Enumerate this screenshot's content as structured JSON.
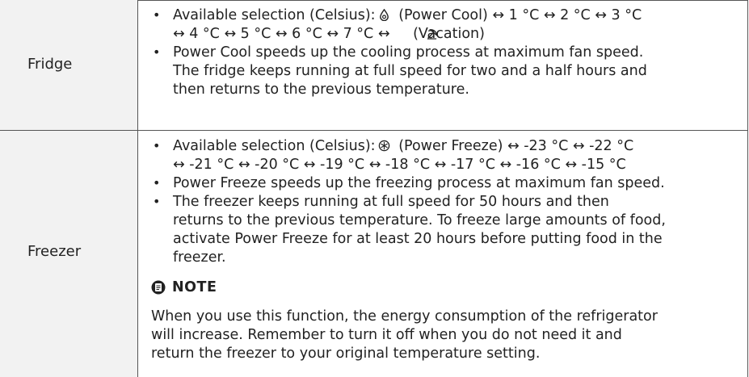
{
  "fridge": {
    "label": "Fridge",
    "bullets": [
      {
        "lines": [
          "Available selection (Celsius):   (Power Cool) ↔ 1 °C ↔ 2 °C ↔ 3 °C",
          "↔ 4 °C ↔ 5 °C ↔ 6 °C ↔ 7 °C ↔   (Vacation)"
        ]
      },
      {
        "lines": [
          "Power Cool speeds up the cooling process at maximum fan speed.",
          "The fridge keeps running at full speed for two and a half hours and",
          "then returns to the previous temperature."
        ]
      }
    ]
  },
  "freezer": {
    "label": "Freezer",
    "bullets": [
      {
        "lines": [
          "Available selection (Celsius):   (Power Freeze) ↔ -23 °C ↔ -22 °C",
          "↔ -21 °C ↔ -20 °C ↔ -19 °C ↔ -18 °C ↔ -17 °C ↔ -16 °C ↔ -15 °C"
        ]
      },
      {
        "lines": [
          "Power Freeze speeds up the freezing process at maximum fan speed."
        ]
      },
      {
        "lines": [
          "The freezer keeps running at full speed for 50 hours and then",
          "returns to the previous temperature. To freeze large amounts of food,",
          "activate Power Freeze for at least 20 hours before putting food in the",
          "freezer."
        ]
      }
    ],
    "note": {
      "heading": "NOTE",
      "lines": [
        "When you use this function, the energy consumption of the refrigerator",
        "will increase. Remember to turn it off when you do not need it and",
        "return the freezer to your original temperature setting."
      ]
    }
  },
  "icons": {
    "power_cool": "power-cool-icon",
    "vacation": "vacation-icon",
    "power_freeze": "power-freeze-icon",
    "note": "note-icon"
  }
}
